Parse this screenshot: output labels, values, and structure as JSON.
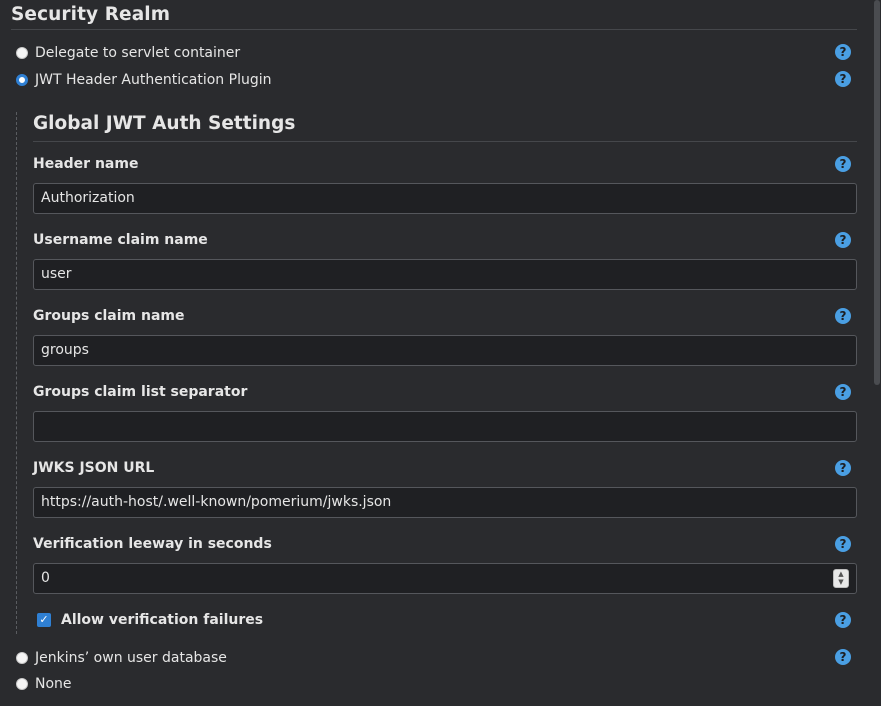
{
  "section": {
    "title": "Security Realm"
  },
  "realm_options": [
    {
      "label": "Delegate to servlet container",
      "selected": false
    },
    {
      "label": "JWT Header Authentication Plugin",
      "selected": true
    },
    {
      "label": "Jenkins’ own user database",
      "selected": false
    },
    {
      "label": "None",
      "selected": false
    }
  ],
  "jwt": {
    "title": "Global JWT Auth Settings",
    "fields": [
      {
        "label": "Header name",
        "value": "Authorization"
      },
      {
        "label": "Username claim name",
        "value": "user"
      },
      {
        "label": "Groups claim name",
        "value": "groups"
      },
      {
        "label": "Groups claim list separator",
        "value": ""
      },
      {
        "label": "JWKS JSON URL",
        "value": "https://auth-host/.well-known/pomerium/jwks.json"
      },
      {
        "label": "Verification leeway in seconds",
        "value": "0"
      }
    ],
    "allow_failures": {
      "label": "Allow verification failures",
      "checked": true
    }
  },
  "help": {
    "glyph": "?"
  },
  "colors": {
    "accent": "#2f80d4",
    "help": "#4a9fe3",
    "background": "#2a2b2e"
  }
}
